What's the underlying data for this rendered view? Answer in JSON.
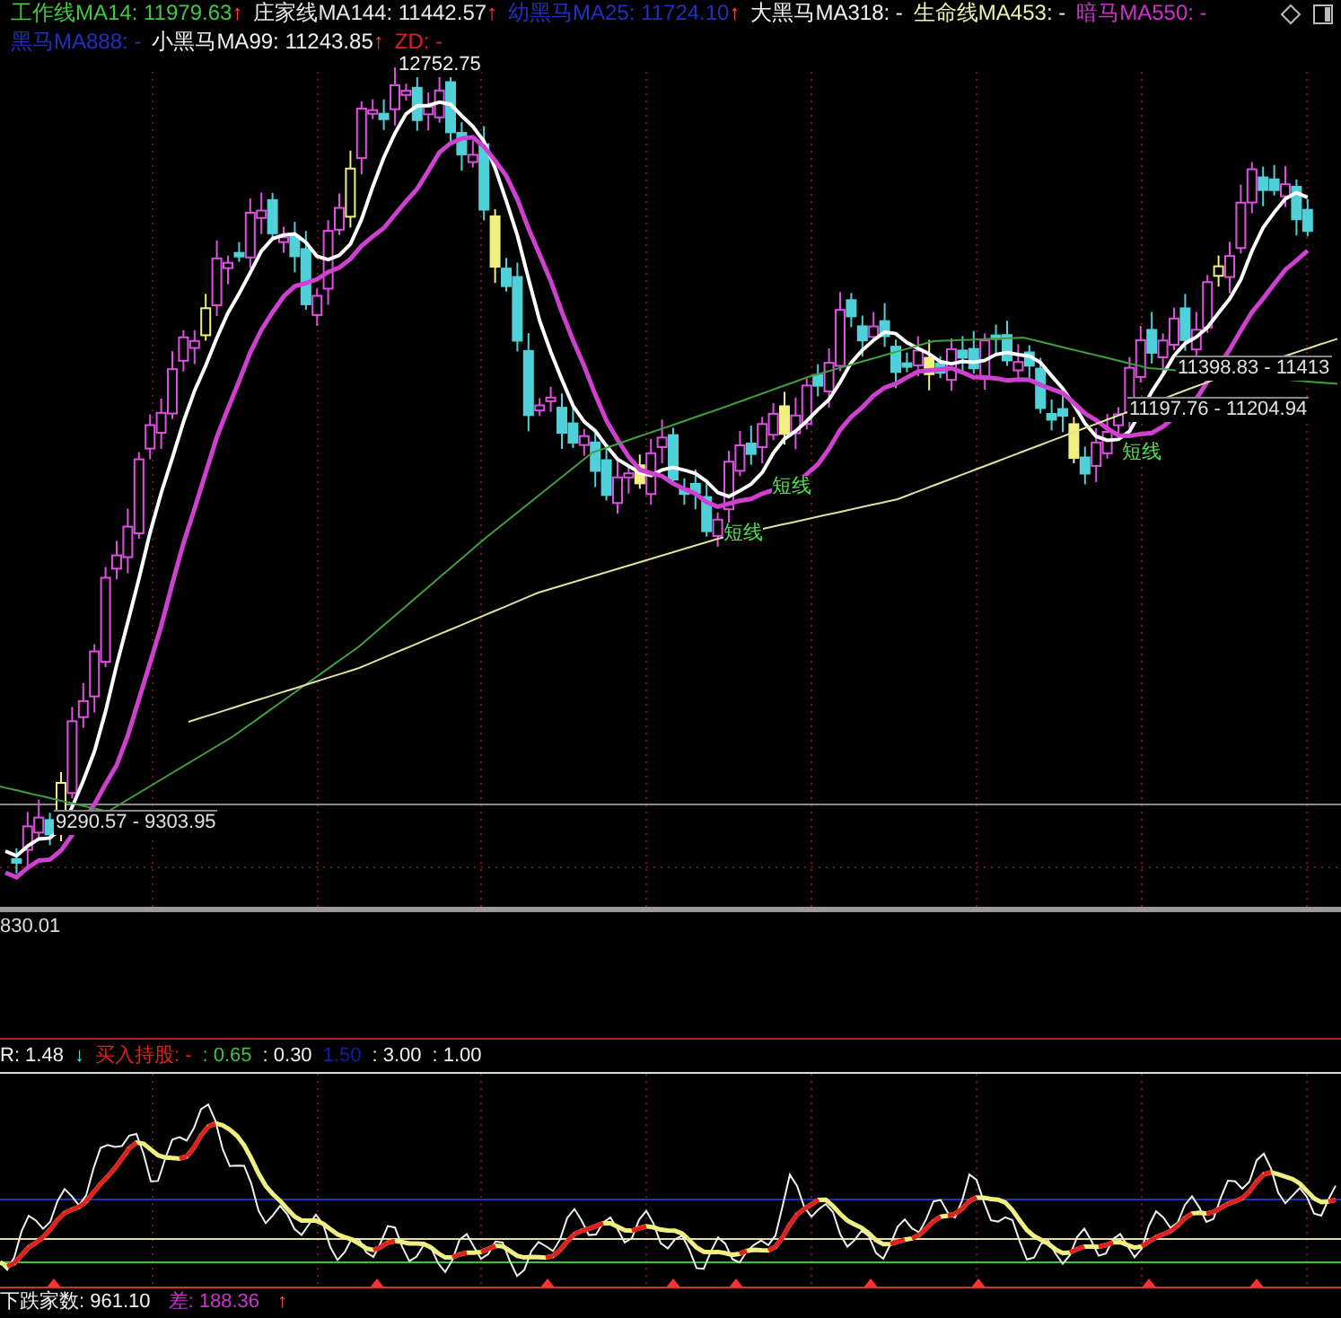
{
  "main_legend": {
    "row1": [
      {
        "label": "工作线MA14: 11979.63",
        "color": "#40c840",
        "arrow": "↑"
      },
      {
        "label": "庄家线MA144: 11442.57",
        "color": "#e8e8e8",
        "arrow": "↑"
      },
      {
        "label": "幼黑马MA25: 11724.10",
        "color": "#2030c0",
        "arrow": "↑"
      },
      {
        "label": "大黑马MA318: -",
        "color": "#f0f0f0"
      },
      {
        "label": "生命线MA453: -",
        "color": "#f0f0b0"
      },
      {
        "label": "暗马MA550: -",
        "color": "#d030d0"
      }
    ],
    "row2": [
      {
        "label": "黑马MA888: -",
        "color": "#2030c0"
      },
      {
        "label": "小黑马MA99: 11243.85",
        "color": "#f0f0f0",
        "arrow": "↑"
      },
      {
        "label": "ZD: -",
        "color": "#e02020"
      }
    ]
  },
  "chart_labels": [
    {
      "text": "12752.75",
      "kind": "peak"
    },
    {
      "text": "9290.57 - 9303.95",
      "kind": "range"
    },
    {
      "text": "11398.83 - 11413",
      "kind": "range"
    },
    {
      "text": "11197.76 - 11204.94",
      "kind": "range"
    },
    {
      "text": "短线",
      "kind": "signal"
    },
    {
      "text": "短线",
      "kind": "signal"
    },
    {
      "text": "短线",
      "kind": "signal"
    }
  ],
  "lower_axis_label": "830.01",
  "indicator_legend": [
    {
      "text": "R: 1.48",
      "color": "#f0f0f0"
    },
    {
      "text": "↓",
      "color": "#40e0e0"
    },
    {
      "text": "买入持股: -",
      "color": "#e02020"
    },
    {
      "text": ": 0.65",
      "color": "#40c040"
    },
    {
      "text": ": 0.30",
      "color": "#f0f0f0"
    },
    {
      "text": "1.50",
      "color": "#1020a0"
    },
    {
      "text": ": 3.00",
      "color": "#f0f0f0"
    },
    {
      "text": ": 1.00",
      "color": "#f0f0f0"
    }
  ],
  "bottom_legend": [
    {
      "text": "下跌家数: 961.10",
      "color": "#f0f0f0"
    },
    {
      "text": "差: 188.36",
      "color": "#d030d0"
    },
    {
      "text": "↑",
      "color": "#ff5050"
    }
  ]
}
